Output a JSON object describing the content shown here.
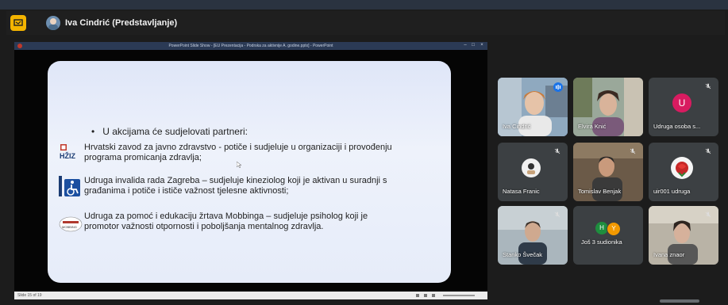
{
  "meeting": {
    "presenter_label": "Iva Cindrić (Predstavljanje)"
  },
  "powerpoint": {
    "title": "PowerPoint Slide Show - [EU Prezentacija - Podrska za aktivnije A. godine.pptx] - PowerPoint",
    "status": "Slide 15 of 19"
  },
  "slide": {
    "bullet": "U akcijama će sudjelovati partneri:",
    "partners": [
      {
        "logo_text": "HŽIZ",
        "line1": "Hrvatski zavod za javno zdravstvo  - potiče i sudjeluje u organizaciji i provođenju",
        "line2": "programa promicanja zdravlja;"
      },
      {
        "logo_text": "",
        "line1": "Udruga invalida rada Zagreba – sudjeluje kineziolog koji je aktivan u suradnji s",
        "line2": "građanima i potiče i ističe važnost tjelesne aktivnosti;"
      },
      {
        "logo_text": "MOBBING",
        "line1": "Udruga za pomoć i edukaciju žrtava Mobbinga – sudjeluje psiholog koji je",
        "line2": "promotor važnosti otpornosti i poboljšanja mentalnog zdravlja."
      }
    ]
  },
  "participants": [
    {
      "name": "Iva Cindrić",
      "avatar_letter": "",
      "speaking": true
    },
    {
      "name": "Elvira Knić",
      "avatar_letter": "",
      "muted": false
    },
    {
      "name": "Udruga osoba s...",
      "avatar_letter": "U",
      "muted": true
    },
    {
      "name": "Natasa Franic",
      "avatar_letter": "",
      "muted": true
    },
    {
      "name": "Tomislav Benjak",
      "avatar_letter": "",
      "muted": true
    },
    {
      "name": "uir001 udruga",
      "avatar_letter": "",
      "muted": true
    },
    {
      "name": "Stanko Švečak",
      "avatar_letter": "",
      "muted": true
    },
    {
      "name": "Još 3 sudionika",
      "avatar_letter": "",
      "others": [
        "H",
        "Y"
      ]
    },
    {
      "name": "Ivana znaor",
      "avatar_letter": "",
      "muted": true
    }
  ],
  "colors": {
    "accent_yellow": "#f4b400",
    "tile_bg": "#3c4043",
    "avatar_u": "#d81b60",
    "avatar_h": "#1e8e3e",
    "avatar_y": "#f29900",
    "speaking_outline": "#8ab4f8"
  }
}
